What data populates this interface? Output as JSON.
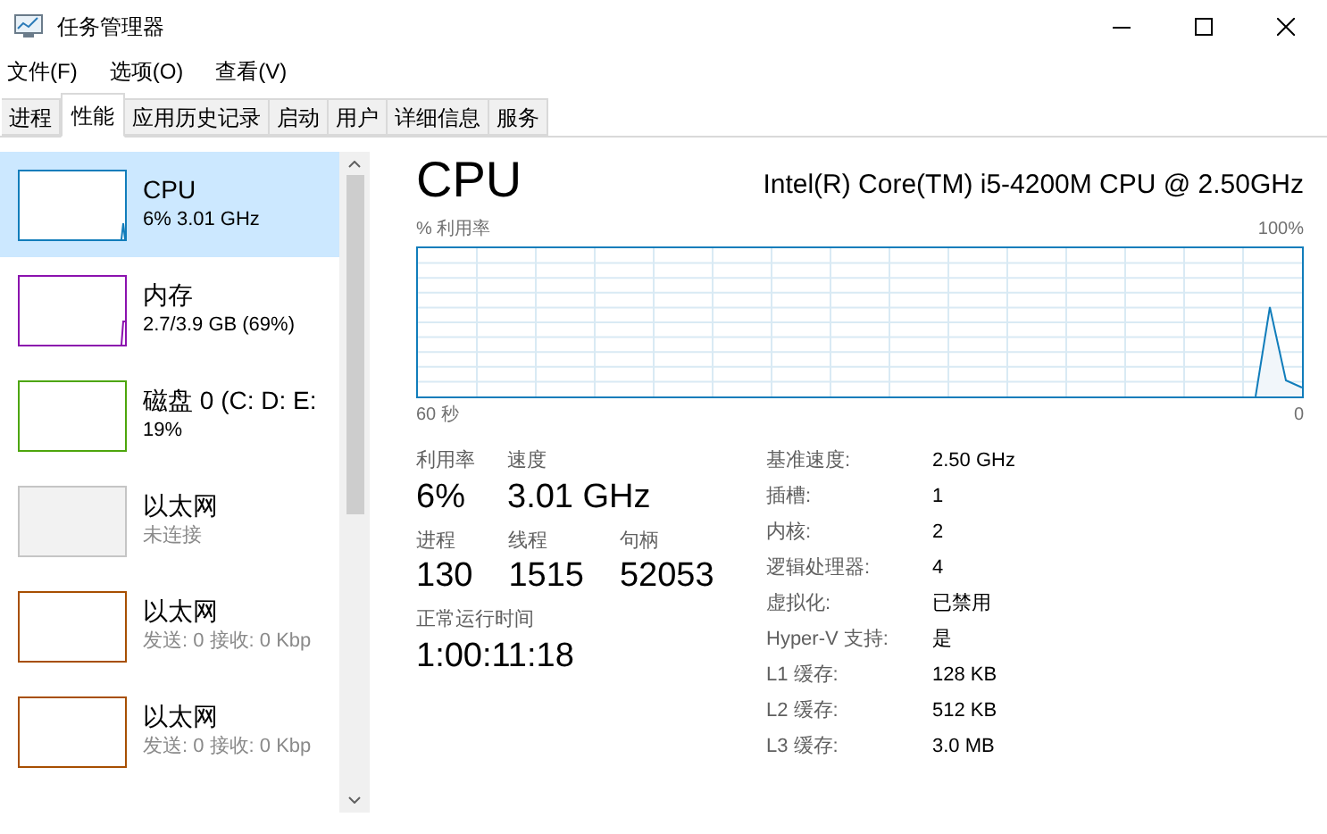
{
  "window": {
    "title": "任务管理器"
  },
  "menu": [
    "文件(F)",
    "选项(O)",
    "查看(V)"
  ],
  "tabs": [
    {
      "label": "进程",
      "selected": false
    },
    {
      "label": "性能",
      "selected": true
    },
    {
      "label": "应用历史记录",
      "selected": false
    },
    {
      "label": "启动",
      "selected": false
    },
    {
      "label": "用户",
      "selected": false
    },
    {
      "label": "详细信息",
      "selected": false
    },
    {
      "label": "服务",
      "selected": false
    }
  ],
  "sidebar": {
    "items": [
      {
        "kind": "cpu",
        "title": "CPU",
        "subtitle": "6% 3.01 GHz",
        "color": "#117dbb",
        "selected": true,
        "disabled": false
      },
      {
        "kind": "memory",
        "title": "内存",
        "subtitle": "2.7/3.9 GB (69%)",
        "color": "#8b12ae",
        "selected": false,
        "disabled": false
      },
      {
        "kind": "disk",
        "title": "磁盘 0 (C: D: E:",
        "subtitle": "19%",
        "color": "#4da60c",
        "selected": false,
        "disabled": false
      },
      {
        "kind": "ethernet",
        "title": "以太网",
        "subtitle": "未连接",
        "color": "#c5c5c5",
        "selected": false,
        "disabled": true
      },
      {
        "kind": "ethernet",
        "title": "以太网",
        "subtitle": "发送: 0 接收: 0 Kbp",
        "color": "#a74f01",
        "selected": false,
        "disabled": false
      },
      {
        "kind": "ethernet",
        "title": "以太网",
        "subtitle": "发送: 0 接收: 0 Kbp",
        "color": "#a74f01",
        "selected": false,
        "disabled": false
      }
    ]
  },
  "detail": {
    "title": "CPU",
    "processor": "Intel(R) Core(TM) i5-4200M CPU @ 2.50GHz",
    "graph": {
      "ylabel": "% 利用率",
      "max_label": "100%",
      "start_label": "60 秒",
      "end_label": "0"
    },
    "stats": [
      {
        "label": "利用率",
        "value": "6%"
      },
      {
        "label": "速度",
        "value": "3.01 GHz"
      }
    ],
    "stats2": [
      {
        "label": "进程",
        "value": "130"
      },
      {
        "label": "线程",
        "value": "1515"
      },
      {
        "label": "句柄",
        "value": "52053"
      }
    ],
    "uptime": {
      "label": "正常运行时间",
      "value": "1:00:11:18"
    },
    "specs": [
      {
        "label": "基准速度:",
        "value": "2.50 GHz"
      },
      {
        "label": "插槽:",
        "value": "1"
      },
      {
        "label": "内核:",
        "value": "2"
      },
      {
        "label": "逻辑处理器:",
        "value": "4"
      },
      {
        "label": "虚拟化:",
        "value": "已禁用"
      },
      {
        "label": "Hyper-V 支持:",
        "value": "是"
      },
      {
        "label": "L1 缓存:",
        "value": "128 KB"
      },
      {
        "label": "L2 缓存:",
        "value": "512 KB"
      },
      {
        "label": "L3 缓存:",
        "value": "3.0 MB"
      }
    ]
  }
}
